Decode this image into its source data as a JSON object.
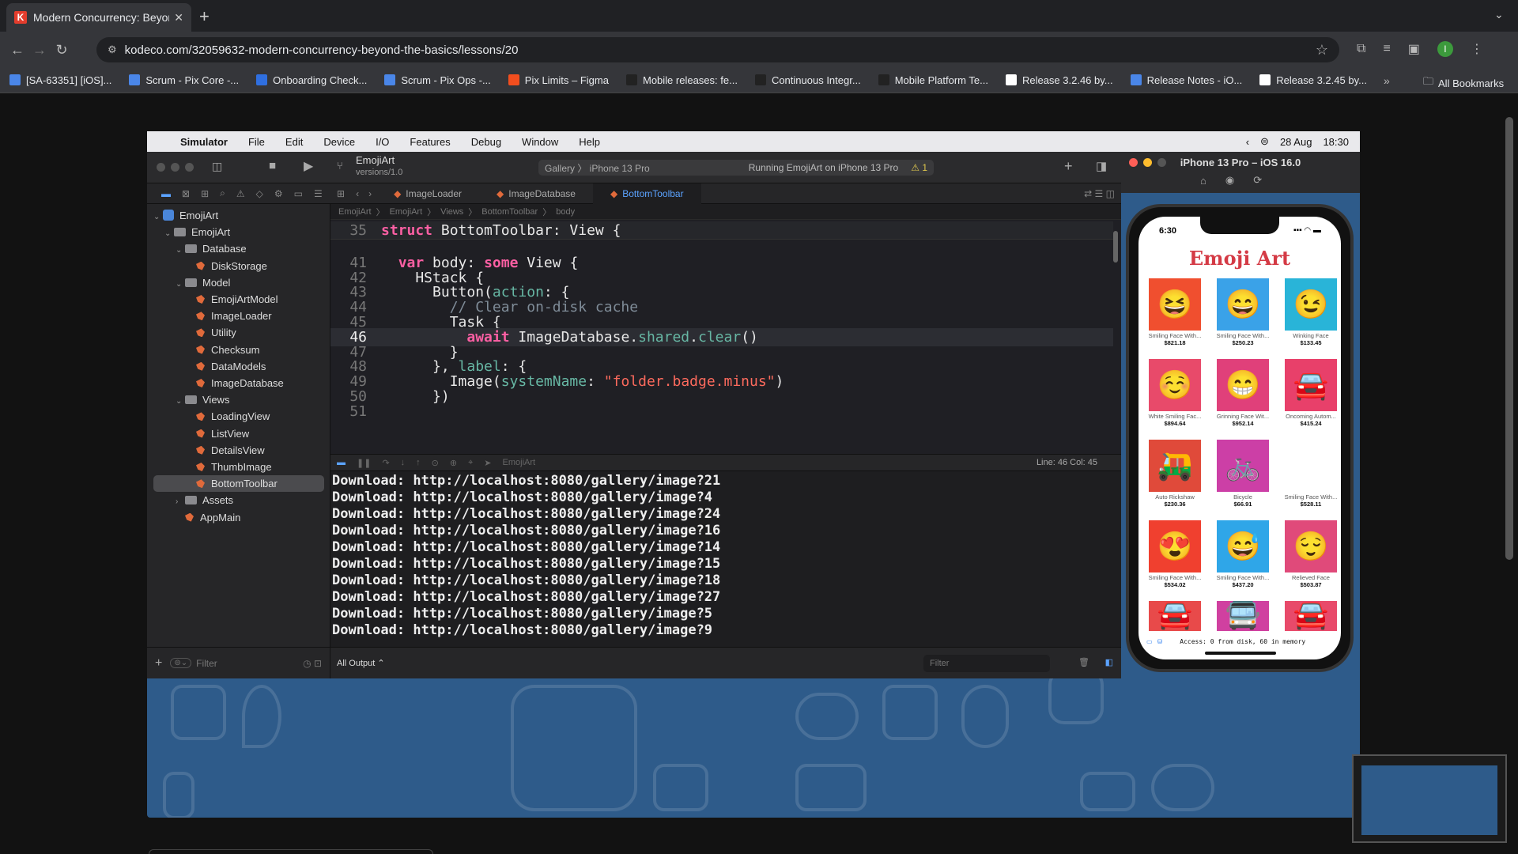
{
  "browser": {
    "tab_title": "Modern Concurrency: Beyond t",
    "url": "kodeco.com/32059632-modern-concurrency-beyond-the-basics/lessons/20",
    "bookmarks": [
      {
        "label": "[SA-63351] [iOS]...",
        "color": "#4a86e8"
      },
      {
        "label": "Scrum - Pix Core -...",
        "color": "#4a86e8"
      },
      {
        "label": "Onboarding Check...",
        "color": "#2f6fe0"
      },
      {
        "label": "Scrum - Pix Ops -...",
        "color": "#4a86e8"
      },
      {
        "label": "Pix Limits – Figma",
        "color": "#f24e1e"
      },
      {
        "label": "Mobile releases: fe...",
        "color": "#222222"
      },
      {
        "label": "Continuous Integr...",
        "color": "#222222"
      },
      {
        "label": "Mobile Platform Te...",
        "color": "#222222"
      },
      {
        "label": "Release 3.2.46 by...",
        "color": "#ffffff"
      },
      {
        "label": "Release Notes - iO...",
        "color": "#4a86e8"
      },
      {
        "label": "Release 3.2.45 by...",
        "color": "#ffffff"
      }
    ],
    "all_bookmarks": "All Bookmarks",
    "profile_initial": "I"
  },
  "mac_menu": {
    "items": [
      "Simulator",
      "File",
      "Edit",
      "Device",
      "I/O",
      "Features",
      "Debug",
      "Window",
      "Help"
    ],
    "date": "28 Aug",
    "time": "18:30"
  },
  "xcode": {
    "scheme_name": "EmojiArt",
    "scheme_version": "versions/1.0",
    "destination": "Gallery 〉 iPhone 13 Pro",
    "status": "Running EmojiArt on iPhone 13 Pro",
    "warning_count": "1",
    "navigator": [
      {
        "label": "EmojiArt",
        "level": 0,
        "kind": "project",
        "open": true
      },
      {
        "label": "EmojiArt",
        "level": 1,
        "kind": "folder",
        "open": true
      },
      {
        "label": "Database",
        "level": 2,
        "kind": "folder",
        "open": true
      },
      {
        "label": "DiskStorage",
        "level": 3,
        "kind": "swift"
      },
      {
        "label": "Model",
        "level": 2,
        "kind": "folder",
        "open": true
      },
      {
        "label": "EmojiArtModel",
        "level": 3,
        "kind": "swift"
      },
      {
        "label": "ImageLoader",
        "level": 3,
        "kind": "swift"
      },
      {
        "label": "Utility",
        "level": 3,
        "kind": "swift"
      },
      {
        "label": "Checksum",
        "level": 3,
        "kind": "swift"
      },
      {
        "label": "DataModels",
        "level": 3,
        "kind": "swift"
      },
      {
        "label": "ImageDatabase",
        "level": 3,
        "kind": "swift"
      },
      {
        "label": "Views",
        "level": 2,
        "kind": "folder",
        "open": true
      },
      {
        "label": "LoadingView",
        "level": 3,
        "kind": "swift"
      },
      {
        "label": "ListView",
        "level": 3,
        "kind": "swift"
      },
      {
        "label": "DetailsView",
        "level": 3,
        "kind": "swift"
      },
      {
        "label": "ThumbImage",
        "level": 3,
        "kind": "swift"
      },
      {
        "label": "BottomToolbar",
        "level": 3,
        "kind": "swift",
        "selected": true
      },
      {
        "label": "Assets",
        "level": 2,
        "kind": "folder",
        "open": false
      },
      {
        "label": "AppMain",
        "level": 2,
        "kind": "swift"
      }
    ],
    "filter_placeholder": "Filter",
    "editor_tabs": [
      "ImageLoader",
      "ImageDatabase",
      "BottomToolbar"
    ],
    "jump_bar": [
      "EmojiArt",
      "EmojiArt",
      "Views",
      "BottomToolbar",
      "body"
    ],
    "code_lines": [
      {
        "n": "35",
        "t": "struct BottomToolbar: View {"
      },
      {
        "n": "41",
        "t": "  var body: some View {"
      },
      {
        "n": "42",
        "t": "    HStack {"
      },
      {
        "n": "43",
        "t": "      Button(action: {"
      },
      {
        "n": "44",
        "t": "        // Clear on-disk cache"
      },
      {
        "n": "45",
        "t": "        Task {"
      },
      {
        "n": "46",
        "t": "          await ImageDatabase.shared.clear()"
      },
      {
        "n": "47",
        "t": "        }"
      },
      {
        "n": "48",
        "t": "      }, label: {"
      },
      {
        "n": "49",
        "t": "        Image(systemName: \"folder.badge.minus\")"
      },
      {
        "n": "50",
        "t": "      })"
      },
      {
        "n": "51",
        "t": ""
      }
    ],
    "debug_target": "EmojiArt",
    "line_col": "Line: 46  Col: 45",
    "console_lines": [
      "Download: http://localhost:8080/gallery/image?21",
      "Download: http://localhost:8080/gallery/image?4",
      "Download: http://localhost:8080/gallery/image?24",
      "Download: http://localhost:8080/gallery/image?16",
      "Download: http://localhost:8080/gallery/image?14",
      "Download: http://localhost:8080/gallery/image?15",
      "Download: http://localhost:8080/gallery/image?18",
      "Download: http://localhost:8080/gallery/image?27",
      "Download: http://localhost:8080/gallery/image?5",
      "Download: http://localhost:8080/gallery/image?9"
    ],
    "output_selector": "All Output ⌃",
    "console_filter": "Filter"
  },
  "simulator": {
    "title": "iPhone 13 Pro – iOS 16.0",
    "time": "6:30",
    "app_title": "Emoji Art",
    "items": [
      {
        "name": "Smiling Face With...",
        "price": "$821.18",
        "emoji": "😆",
        "bg": "#f04f2f"
      },
      {
        "name": "Smiling Face With...",
        "price": "$250.23",
        "emoji": "😄",
        "bg": "#3aa2e8"
      },
      {
        "name": "Winking Face",
        "price": "$133.45",
        "emoji": "😉",
        "bg": "#29b4d8"
      },
      {
        "name": "White Smiling Fac...",
        "price": "$894.64",
        "emoji": "☺️",
        "bg": "#e84a6a"
      },
      {
        "name": "Grinning Face Wit...",
        "price": "$952.14",
        "emoji": "😁",
        "bg": "#e0407a"
      },
      {
        "name": "Oncoming Autom...",
        "price": "$415.24",
        "emoji": "🚘",
        "bg": "#e8406a"
      },
      {
        "name": "Auto Rickshaw",
        "price": "$230.36",
        "emoji": "🛺",
        "bg": "#e04a3a"
      },
      {
        "name": "Bicycle",
        "price": "$66.91",
        "emoji": "🚲",
        "bg": "#cc3fa6"
      },
      {
        "name": "Smiling Face With...",
        "price": "$528.11",
        "emoji": "",
        "bg": "#ffffff"
      },
      {
        "name": "Smiling Face With...",
        "price": "$534.02",
        "emoji": "😍",
        "bg": "#f0402f"
      },
      {
        "name": "Smiling Face With...",
        "price": "$437.20",
        "emoji": "😅",
        "bg": "#2fa6e8"
      },
      {
        "name": "Relieved Face",
        "price": "$503.87",
        "emoji": "😌",
        "bg": "#e04a7a"
      },
      {
        "name": "",
        "price": "",
        "emoji": "🚘",
        "bg": "#e84a4a"
      },
      {
        "name": "",
        "price": "",
        "emoji": "🚍",
        "bg": "#d040a0"
      },
      {
        "name": "",
        "price": "",
        "emoji": "🚘",
        "bg": "#e84a6a"
      }
    ],
    "access_text": "Access: 0 from disk, 60 in memory"
  }
}
